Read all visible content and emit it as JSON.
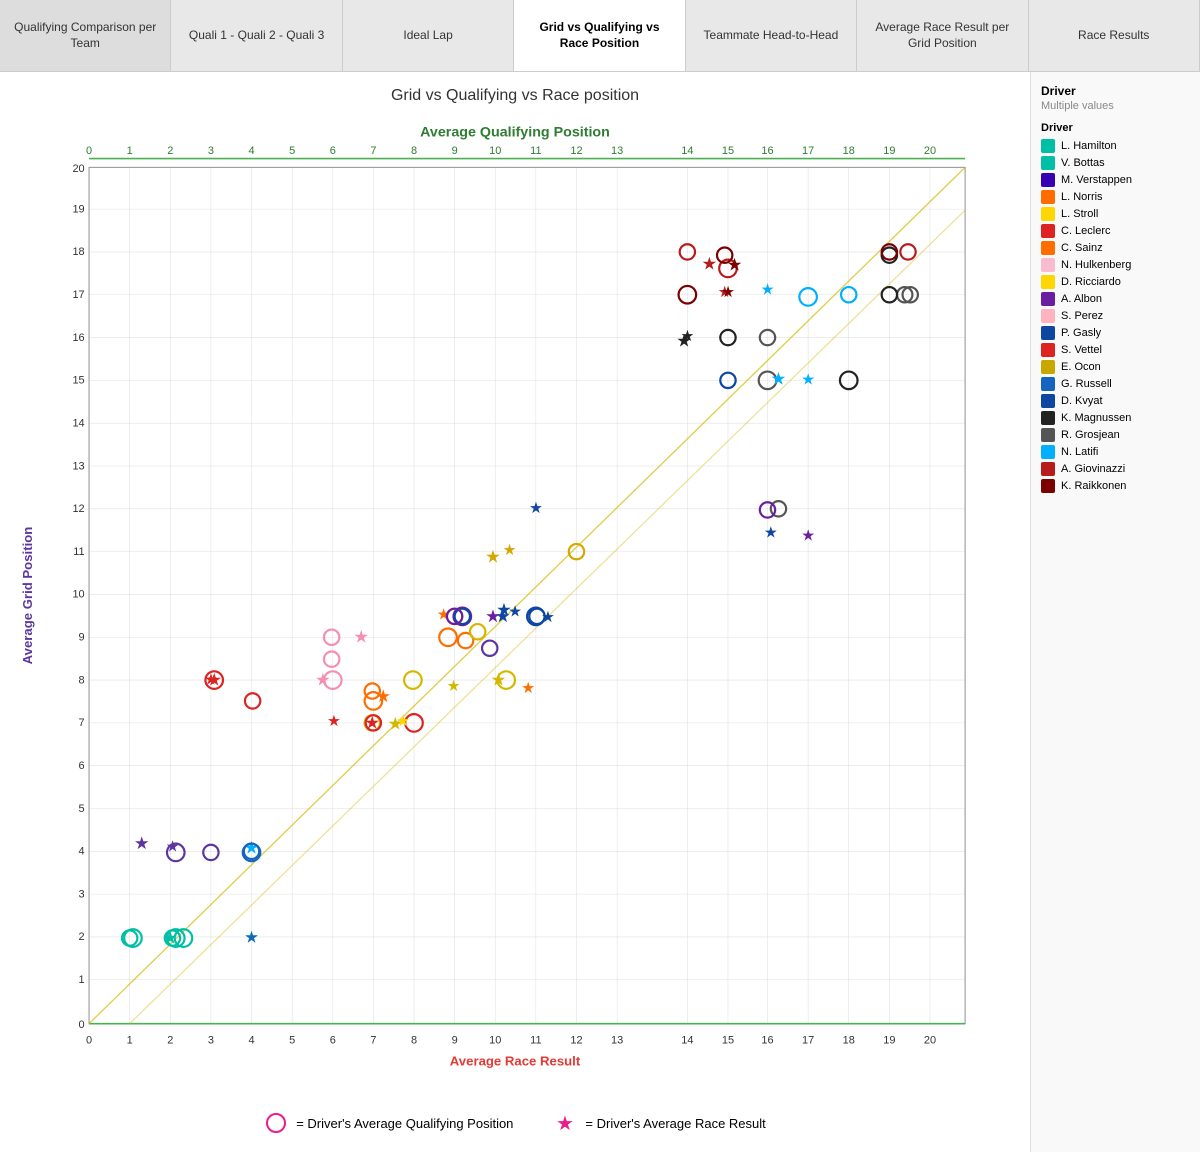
{
  "tabs": [
    {
      "label": "Qualifying Comparison per Team",
      "active": false
    },
    {
      "label": "Quali 1 - Quali 2 - Quali 3",
      "active": false
    },
    {
      "label": "Ideal Lap",
      "active": false
    },
    {
      "label": "Grid vs Qualifying vs Race Position",
      "active": true
    },
    {
      "label": "Teammate Head-to-Head",
      "active": false
    },
    {
      "label": "Average Race Result per Grid Position",
      "active": false
    },
    {
      "label": "Race Results",
      "active": false
    }
  ],
  "chart": {
    "title": "Grid vs Qualifying vs Race position",
    "x_axis_label": "Average Race Result",
    "y_axis_label": "Average Grid Position",
    "top_axis_label": "Average  Qualifying  Position"
  },
  "legend_bottom": [
    {
      "symbol": "circle",
      "label": "= Driver's Average Qualifying Position"
    },
    {
      "symbol": "star",
      "label": "= Driver's Average Race Result"
    }
  ],
  "right_panel": {
    "title": "Driver",
    "subtitle": "Multiple values",
    "driver_label": "Driver",
    "drivers": [
      {
        "name": "L. Hamilton",
        "color": "#00BFA5"
      },
      {
        "name": "V. Bottas",
        "color": "#00BFA5"
      },
      {
        "name": "M. Verstappen",
        "color": "#3700B3"
      },
      {
        "name": "L. Norris",
        "color": "#FF6D00"
      },
      {
        "name": "L. Stroll",
        "color": "#FFD600"
      },
      {
        "name": "C. Leclerc",
        "color": "#DD2222"
      },
      {
        "name": "C. Sainz",
        "color": "#FF6D00"
      },
      {
        "name": "N. Hulkenberg",
        "color": "#F8BBD0"
      },
      {
        "name": "D. Ricciardo",
        "color": "#FFD600"
      },
      {
        "name": "A. Albon",
        "color": "#6A1FA0"
      },
      {
        "name": "S. Perez",
        "color": "#FFB3C1"
      },
      {
        "name": "P. Gasly",
        "color": "#0D47A1"
      },
      {
        "name": "S. Vettel",
        "color": "#DD2222"
      },
      {
        "name": "E. Ocon",
        "color": "#C8A800"
      },
      {
        "name": "G. Russell",
        "color": "#1565C0"
      },
      {
        "name": "D. Kvyat",
        "color": "#0D47A1"
      },
      {
        "name": "K. Magnussen",
        "color": "#222222"
      },
      {
        "name": "R. Grosjean",
        "color": "#555555"
      },
      {
        "name": "N. Latifi",
        "color": "#00B0FF"
      },
      {
        "name": "A. Giovinazzi",
        "color": "#B71C1C"
      },
      {
        "name": "K. Raikkonen",
        "color": "#7B0000"
      }
    ]
  }
}
